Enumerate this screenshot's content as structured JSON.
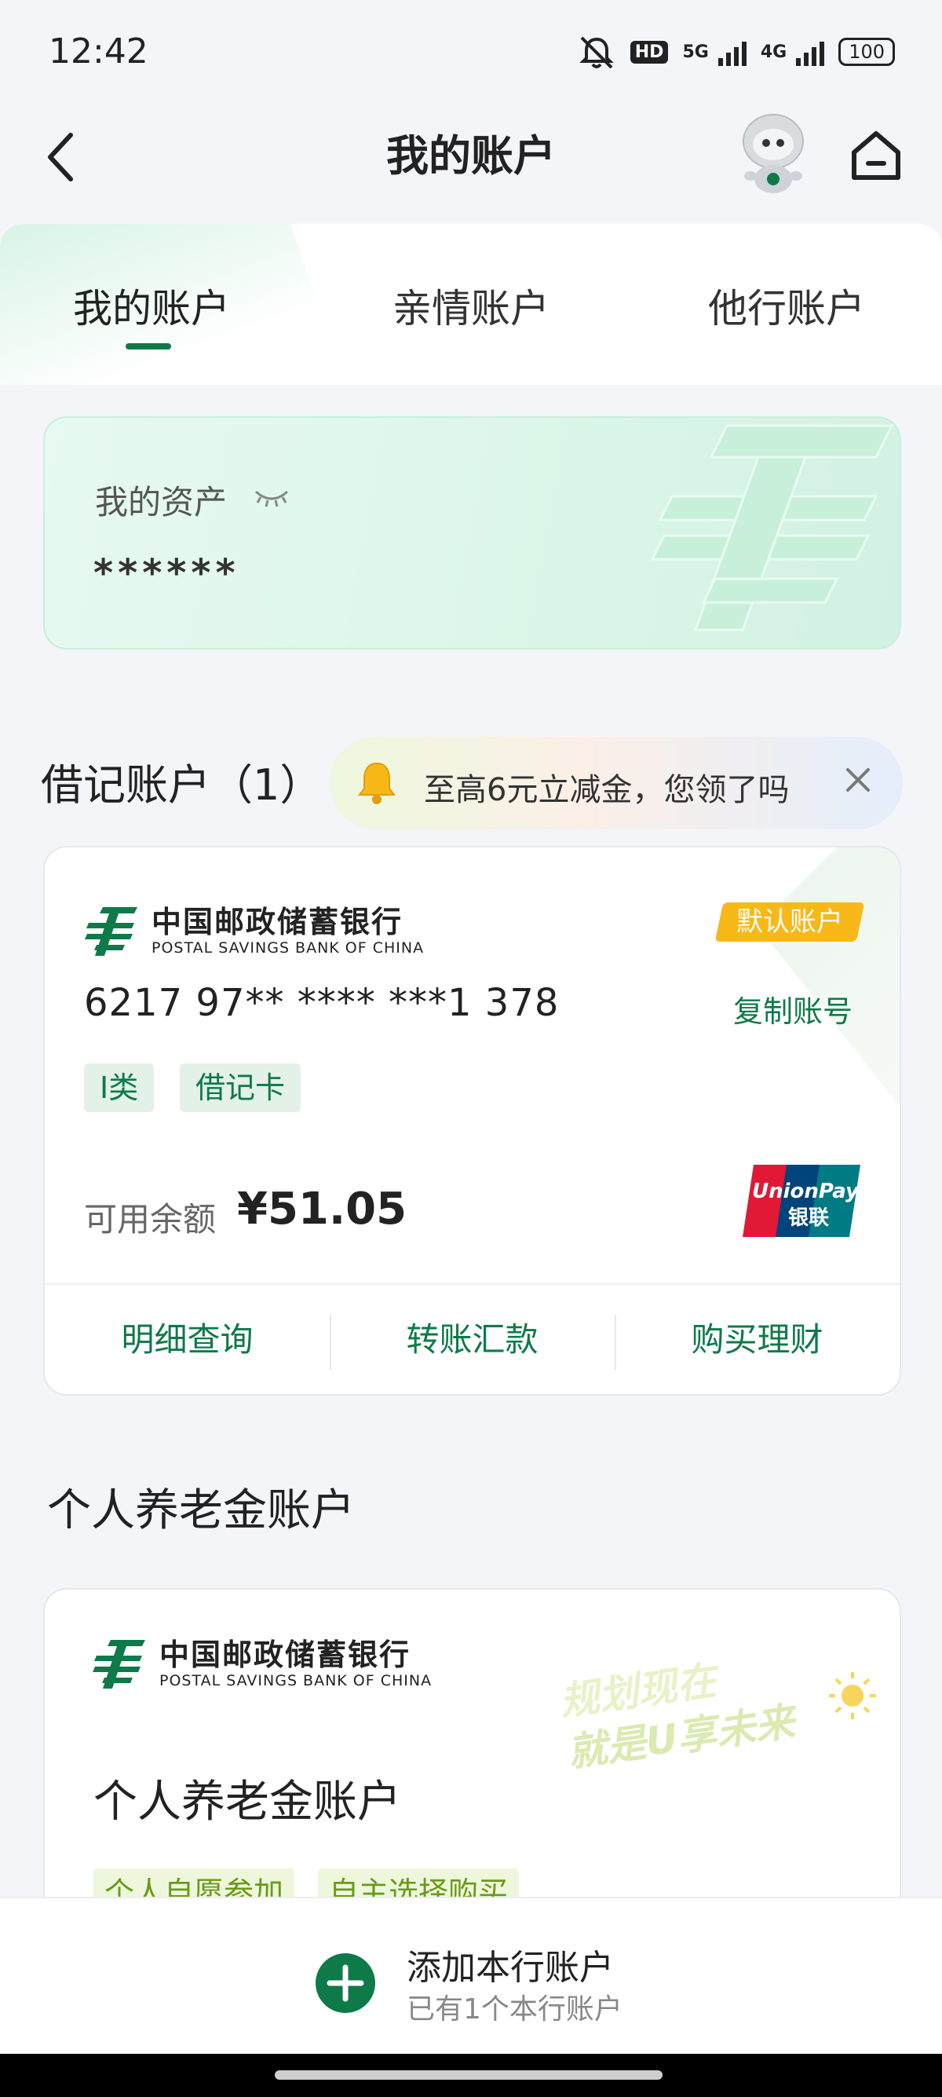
{
  "status_bar": {
    "time": "12:42",
    "net1": "5G",
    "net2": "4G",
    "hd": "HD",
    "battery": "100"
  },
  "header": {
    "title": "我的账户"
  },
  "tabs": [
    {
      "label": "我的账户",
      "active": true
    },
    {
      "label": "亲情账户",
      "active": false
    },
    {
      "label": "他行账户",
      "active": false
    }
  ],
  "assets": {
    "label": "我的资产",
    "value": "******"
  },
  "debit": {
    "title": "借记账户（1）",
    "promo": "至高6元立减金，您领了吗",
    "card": {
      "bank_cn": "中国邮政储蓄银行",
      "bank_en": "POSTAL SAVINGS BANK OF CHINA",
      "badge": "默认账户",
      "number": "6217 97** **** ***1 378",
      "copy": "复制账号",
      "tags": [
        "I类",
        "借记卡"
      ],
      "balance_label": "可用余额",
      "balance": "¥51.05",
      "actions": [
        "明细查询",
        "转账汇款",
        "购买理财"
      ]
    }
  },
  "pension": {
    "title": "个人养老金账户",
    "bank_cn": "中国邮政储蓄银行",
    "bank_en": "POSTAL SAVINGS BANK OF CHINA",
    "slogan_line1": "规划现在",
    "slogan_line2": "就是U享未来",
    "name": "个人养老金账户",
    "tags": [
      "个人自愿参加",
      "自主选择购买"
    ]
  },
  "bottom": {
    "add_title": "添加本行账户",
    "add_sub": "已有1个本行账户"
  },
  "colors": {
    "brand_green": "#0e7a49",
    "badge_yellow": "#f7b818"
  }
}
